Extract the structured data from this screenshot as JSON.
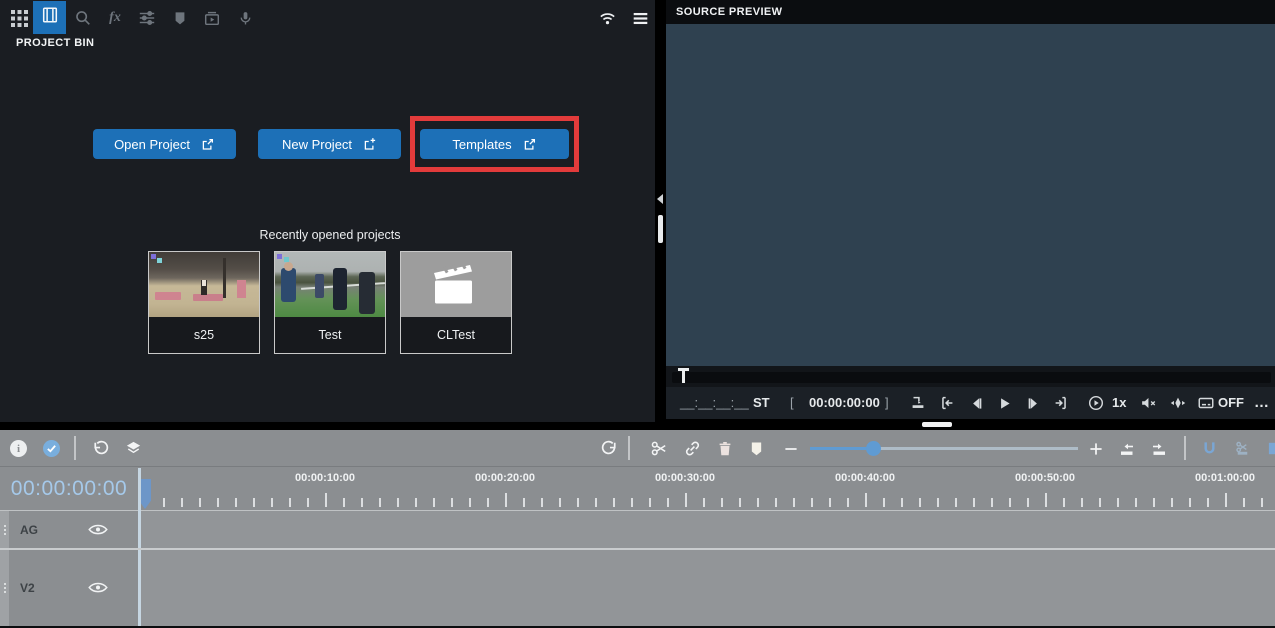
{
  "colors": {
    "accent_blue": "#1d70b7",
    "highlight_red": "#e23b3b",
    "panel_dark": "#1a1d22",
    "preview_slate": "#2f4150",
    "timeline_gray": "#8b8e91",
    "ruler_timecode_blue": "#a5c9ea"
  },
  "top_toolbar": {
    "effects_glyph": "fx"
  },
  "project_bin": {
    "title": "PROJECT BIN",
    "buttons": {
      "open": "Open Project",
      "new": "New Project",
      "templates": "Templates"
    },
    "recent_title": "Recently opened projects",
    "recent_projects": [
      {
        "name": "s25"
      },
      {
        "name": "Test"
      },
      {
        "name": "CLTest"
      }
    ]
  },
  "source_preview": {
    "title": "SOURCE PREVIEW",
    "transport": {
      "timecode_placeholder": "__:__:__:__",
      "st_label": "ST",
      "in_bracket": "[",
      "current_timecode": "00:00:00:00",
      "out_bracket": "]",
      "speed_label": "1x",
      "captions_label": "OFF",
      "more_label": "…"
    }
  },
  "timeline": {
    "current_timecode": "00:00:00:00",
    "ruler": {
      "labels": [
        "00:00:10:00",
        "00:00:20:00",
        "00:00:30:00",
        "00:00:40:00",
        "00:00:50:00",
        "00:01:00:00"
      ]
    },
    "tracks": [
      {
        "name": "AG"
      },
      {
        "name": "V2"
      }
    ]
  }
}
